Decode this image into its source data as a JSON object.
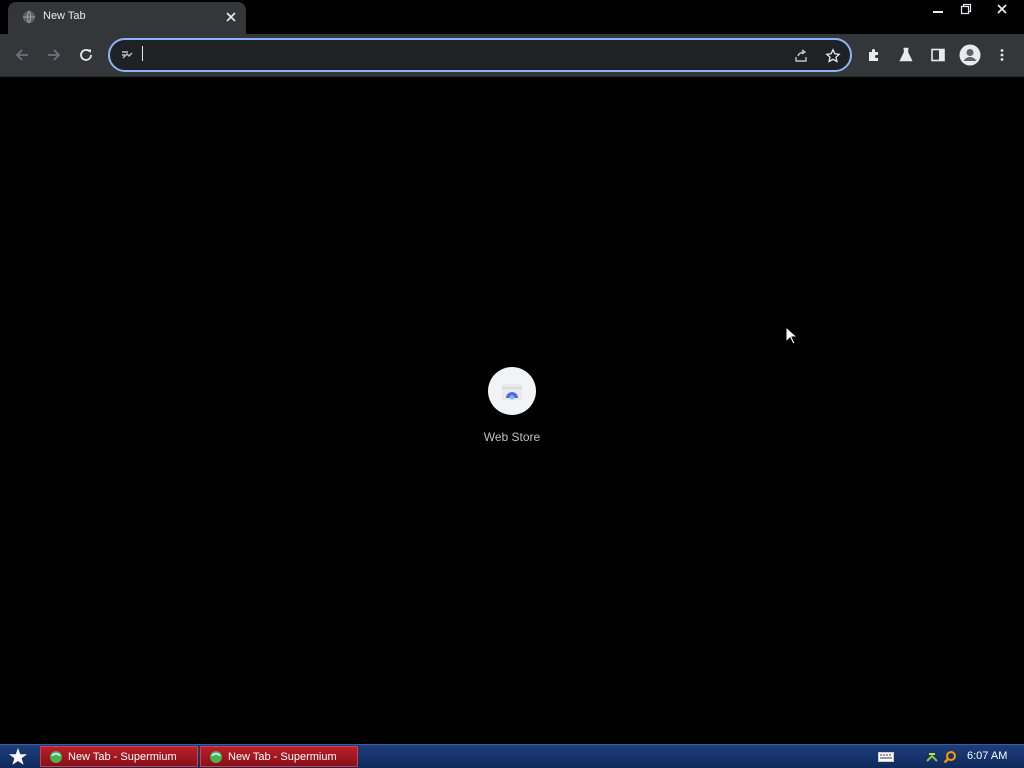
{
  "window": {
    "tab": {
      "title": "New Tab",
      "favicon": "globe-icon",
      "close": "close-icon"
    },
    "controls": [
      "minimize-icon",
      "restore-icon",
      "close-icon"
    ]
  },
  "toolbar": {
    "back": "arrow-left-icon",
    "forward": "arrow-right-icon",
    "reload": "reload-icon",
    "omnibox": {
      "value": "",
      "placeholder": "",
      "site_icon": "site-info-icon",
      "share": "share-icon",
      "bookmark": "star-icon"
    },
    "extensions": "puzzle-icon",
    "labs": "flask-icon",
    "side_panel": "side-panel-icon",
    "profile": "avatar-icon",
    "menu": "kebab-menu-icon"
  },
  "content": {
    "shortcuts": [
      {
        "label": "Web Store",
        "icon": "webstore-icon"
      }
    ]
  },
  "taskbar": {
    "start": "start-star-icon",
    "items": [
      {
        "label": "New Tab - Supermium",
        "icon": "supermium-icon"
      },
      {
        "label": "New Tab - Supermium",
        "icon": "supermium-icon"
      }
    ],
    "tray": [
      "keyboard-icon",
      "network-icon",
      "search-tray-icon"
    ],
    "clock": "6:07 AM"
  },
  "colors": {
    "accent": "#8ab4f8",
    "toolbar_bg": "#35363a",
    "omnibox_bg": "#202124",
    "taskbar_bg": "#163468",
    "task_item_bg": "#a81820"
  }
}
